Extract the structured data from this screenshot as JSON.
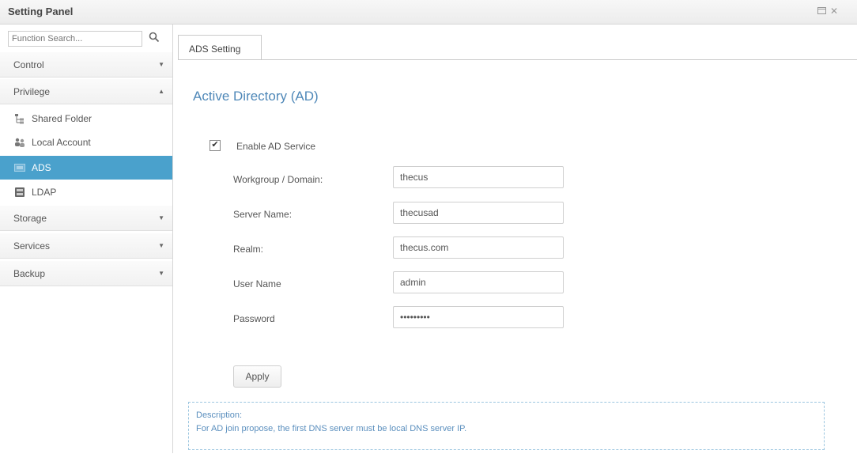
{
  "window": {
    "title": "Setting Panel"
  },
  "sidebar": {
    "search_placeholder": "Function Search...",
    "sections": [
      {
        "label": "Control",
        "arrow": "▼"
      },
      {
        "label": "Privilege",
        "arrow": "▲"
      },
      {
        "label": "Storage",
        "arrow": "▼"
      },
      {
        "label": "Services",
        "arrow": "▼"
      },
      {
        "label": "Backup",
        "arrow": "▼"
      }
    ],
    "privilege_items": [
      {
        "label": "Shared Folder",
        "icon": "folder-tree-icon"
      },
      {
        "label": "Local Account",
        "icon": "users-icon"
      },
      {
        "label": "ADS",
        "icon": "ads-icon",
        "active": true
      },
      {
        "label": "LDAP",
        "icon": "ldap-icon"
      }
    ]
  },
  "tab": {
    "label": "ADS Setting"
  },
  "form": {
    "section_title": "Active Directory (AD)",
    "enable_label": "Enable AD Service",
    "enabled": true,
    "fields": [
      {
        "label": "Workgroup / Domain:",
        "value": "thecus"
      },
      {
        "label": "Server Name:",
        "value": "thecusad"
      },
      {
        "label": "Realm:",
        "value": "thecus.com"
      },
      {
        "label": "User Name",
        "value": "admin"
      },
      {
        "label": "Password",
        "value": "•••••••••"
      }
    ],
    "apply_label": "Apply"
  },
  "description": {
    "title": "Description:",
    "text": "For AD join propose, the first DNS server must be local DNS server IP."
  },
  "colors": {
    "accent": "#4aa1cc",
    "title_blue": "#4f88b8",
    "desc_blue": "#5b8fbe"
  }
}
